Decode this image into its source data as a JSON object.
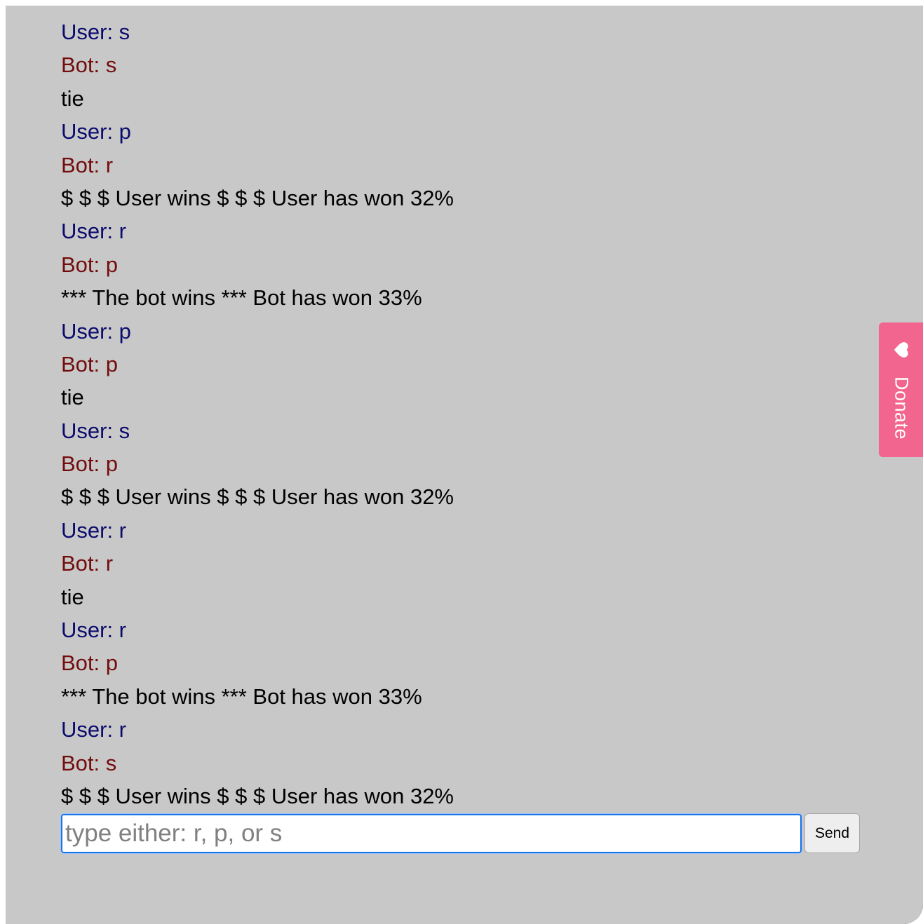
{
  "chat": {
    "messages": [
      {
        "type": "user",
        "text": "User: s"
      },
      {
        "type": "bot",
        "text": "Bot: s"
      },
      {
        "type": "result",
        "text": "tie"
      },
      {
        "type": "user",
        "text": "User: p"
      },
      {
        "type": "bot",
        "text": "Bot: r"
      },
      {
        "type": "result",
        "text": "$ $ $ User wins $ $ $ User has won 32%"
      },
      {
        "type": "user",
        "text": "User: r"
      },
      {
        "type": "bot",
        "text": "Bot: p"
      },
      {
        "type": "result",
        "text": "*** The bot wins *** Bot has won 33%"
      },
      {
        "type": "user",
        "text": "User: p"
      },
      {
        "type": "bot",
        "text": "Bot: p"
      },
      {
        "type": "result",
        "text": "tie"
      },
      {
        "type": "user",
        "text": "User: s"
      },
      {
        "type": "bot",
        "text": "Bot: p"
      },
      {
        "type": "result",
        "text": "$ $ $ User wins $ $ $ User has won 32%"
      },
      {
        "type": "user",
        "text": "User: r"
      },
      {
        "type": "bot",
        "text": "Bot: r"
      },
      {
        "type": "result",
        "text": "tie"
      },
      {
        "type": "user",
        "text": "User: r"
      },
      {
        "type": "bot",
        "text": "Bot: p"
      },
      {
        "type": "result",
        "text": "*** The bot wins *** Bot has won 33%"
      },
      {
        "type": "user",
        "text": "User: r"
      },
      {
        "type": "bot",
        "text": "Bot: s"
      },
      {
        "type": "result",
        "text": "$ $ $ User wins $ $ $ User has won 32%"
      }
    ]
  },
  "input": {
    "value": "",
    "placeholder": "type either: r, p, or s"
  },
  "send_button": {
    "label": "Send"
  },
  "donate": {
    "label": "Donate",
    "icon": "heart-icon",
    "color": "#f2658e"
  },
  "colors": {
    "background": "#c8c8c8",
    "user_text": "#0b0b6e",
    "bot_text": "#730c0c",
    "result_text": "#000000"
  }
}
